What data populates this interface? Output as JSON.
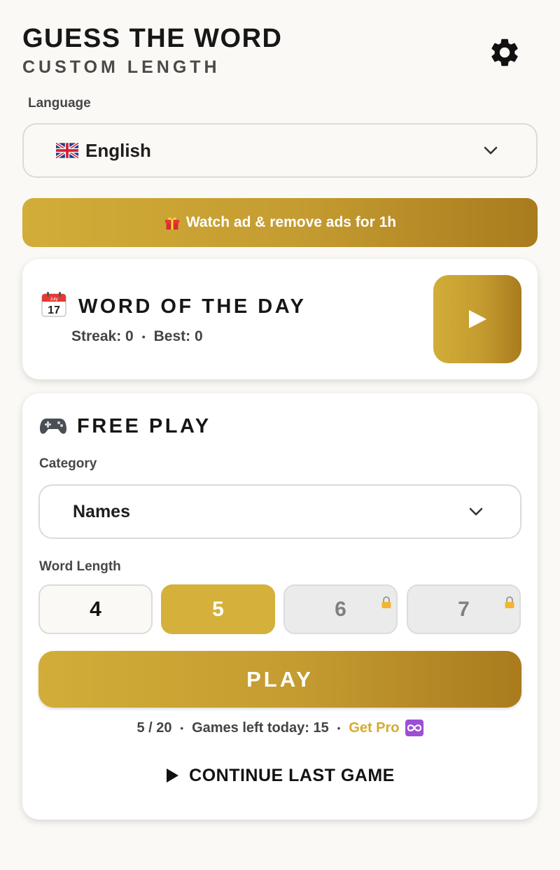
{
  "header": {
    "title": "GUESS THE WORD",
    "subtitle": "CUSTOM LENGTH",
    "settings_icon": "gear-icon"
  },
  "language": {
    "label": "Language",
    "selected": "English",
    "flag_icon": "uk-flag-icon"
  },
  "ad_banner": {
    "text": "Watch ad & remove ads for 1h",
    "icon": "gift-icon"
  },
  "word_of_the_day": {
    "icon": "calendar-icon",
    "calendar_month": "July",
    "calendar_day": "17",
    "title": "WORD OF THE DAY",
    "streak_text": "Streak: 0",
    "separator": "•",
    "best_text": "Best: 0",
    "play_icon": "play-icon"
  },
  "free_play": {
    "icon": "gamepad-icon",
    "title": "FREE PLAY",
    "category_label": "Category",
    "category_selected": "Names",
    "word_length_label": "Word Length",
    "lengths": [
      {
        "label": "4",
        "state": "available"
      },
      {
        "label": "5",
        "state": "selected"
      },
      {
        "label": "6",
        "state": "locked"
      },
      {
        "label": "7",
        "state": "locked"
      }
    ],
    "play_label": "PLAY",
    "progress_text": "5 / 20",
    "separator": "•",
    "games_left_text": "Games left today: 15",
    "get_pro_text": "Get Pro",
    "continue_label": "CONTINUE LAST GAME"
  },
  "colors": {
    "accent_gold": "#d5b03a",
    "accent_gold_dark": "#a97b1d",
    "background": "#fbf9f5",
    "pro_text": "#d5ab2f"
  }
}
